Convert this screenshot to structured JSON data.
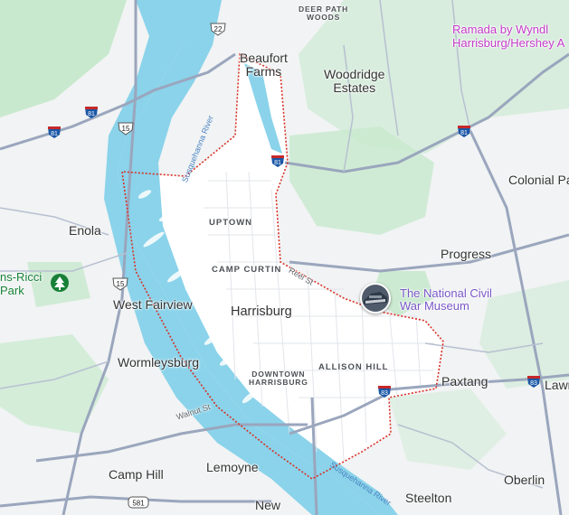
{
  "colors": {
    "water": "#8ad3ea",
    "park": "#bfe6c5",
    "land": "#f1f3f4",
    "city_fill": "#ffffff",
    "road_major": "#9aa6bd",
    "boundary": "#d93025",
    "poi_hotel": "#c43bc9",
    "poi_museum": "#7b57c9",
    "park_label": "#188038"
  },
  "places": {
    "beaufort_farms": "Beaufort\nFarms",
    "woodridge_estates": "Woodridge\nEstates",
    "deer_path_woods": "DEER PATH\nWOODS",
    "enola": "Enola",
    "west_fairview": "West Fairview",
    "harrisburg": "Harrisburg",
    "wormleysburg": "Wormleysburg",
    "camp_hill": "Camp Hill",
    "lemoyne": "Lemoyne",
    "new_cumberland": "New",
    "steelton": "Steelton",
    "oberlin": "Oberlin",
    "paxtang": "Paxtang",
    "lawnton": "Lawn",
    "progress": "Progress",
    "colonial_park": "Colonial Park"
  },
  "neighborhoods": {
    "uptown": "UPTOWN",
    "camp_curtin": "CAMP CURTIN",
    "downtown": "DOWNTOWN\nHARRISBURG",
    "allison_hill": "ALLISON HILL"
  },
  "pois": {
    "ramada": "Ramada by Wyndl\nHarrisburg/Hershey A",
    "museum": "The National Civil\nWar Museum",
    "park": "ns-Ricci\nPark"
  },
  "rivers": {
    "upper": "Susquehanna River",
    "lower": "Susquehanna River"
  },
  "streets": {
    "reel": "Reel St",
    "walnut": "Walnut St"
  },
  "shields": {
    "us22": "22",
    "i81_left": "81",
    "i81_mid": "81",
    "i81_right": "81",
    "us15_top": "15",
    "us15_bottom": "15",
    "i83_center": "83",
    "i83_right": "83",
    "route581": "581"
  },
  "icons": {
    "park_icon": "tree-icon",
    "museum_icon": "museum-photo-icon"
  }
}
